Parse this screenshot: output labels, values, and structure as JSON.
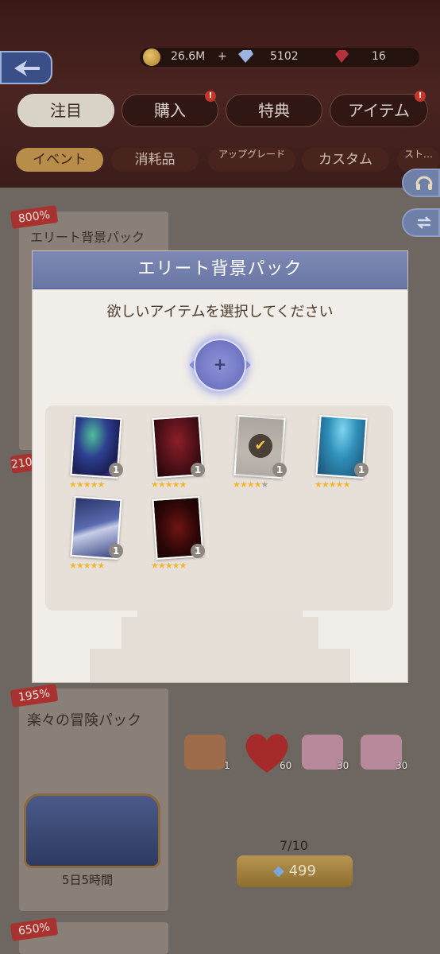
{
  "header": {
    "resources": {
      "coins": "26.6M",
      "plus": "+",
      "gems": "5102",
      "rubies": "16"
    },
    "tabs": [
      {
        "label": "注目"
      },
      {
        "label": "購入"
      },
      {
        "label": "特典"
      },
      {
        "label": "アイテム"
      }
    ],
    "tab_badge": "!",
    "subtabs": [
      {
        "label": "イベント"
      },
      {
        "label": "消耗品"
      },
      {
        "label": "アップグレード"
      },
      {
        "label": "カスタム"
      },
      {
        "label": "スト…"
      }
    ]
  },
  "shop": {
    "cards": [
      {
        "discount": "800%",
        "title": "エリート背景パック"
      },
      {
        "discount": "210%",
        "title": ""
      },
      {
        "discount": "195%",
        "title": "楽々の冒険パック",
        "timer": "5日5時間"
      },
      {
        "discount": "650%",
        "title": ""
      }
    ],
    "rewards": [
      {
        "name": "ticket-icon",
        "count": "1"
      },
      {
        "name": "heart-icon",
        "count": "60"
      },
      {
        "name": "gift-icon",
        "count": "30"
      },
      {
        "name": "gift-icon",
        "count": "30"
      }
    ],
    "progress": "7/10",
    "price": "499"
  },
  "modal": {
    "title": "エリート背景パック",
    "subtitle": "欲しいアイテムを選択してください",
    "slot_plus": "+",
    "items": [
      {
        "name": "aurora-city-background",
        "quantity": "1",
        "stars": 5,
        "selected": false
      },
      {
        "name": "red-forest-background",
        "quantity": "1",
        "stars": 5,
        "selected": false
      },
      {
        "name": "grey-background",
        "quantity": "1",
        "stars": 4,
        "selected": true
      },
      {
        "name": "underwater-ruins-background",
        "quantity": "1",
        "stars": 5,
        "selected": false
      },
      {
        "name": "starry-sky-background",
        "quantity": "1",
        "stars": 5,
        "selected": false
      },
      {
        "name": "dark-red-background",
        "quantity": "1",
        "stars": 5,
        "selected": false
      }
    ]
  },
  "colors": {
    "modal_header": "#7d88b4",
    "modal_body": "#f1ede8",
    "star": "#f2b630",
    "discount_badge": "#a8322f"
  }
}
